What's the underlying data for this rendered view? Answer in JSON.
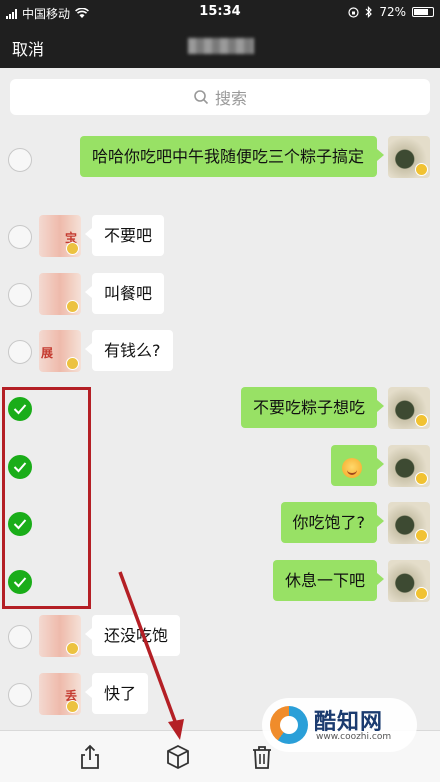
{
  "status_bar": {
    "carrier": "中国移动",
    "time": "15:34",
    "battery": "72%"
  },
  "nav": {
    "cancel_label": "取消"
  },
  "search": {
    "placeholder": "搜索"
  },
  "messages": [
    {
      "side": "me",
      "text": "哈哈你吃吧中午我随便吃三个粽子搞定",
      "checked": false
    },
    {
      "side": "other",
      "text": "不要吧",
      "checked": false,
      "avatar_mark": "宝"
    },
    {
      "side": "other",
      "text": "叫餐吧",
      "checked": false,
      "avatar_mark": ""
    },
    {
      "side": "other",
      "text": "有钱么?",
      "checked": false,
      "avatar_mark": "展"
    },
    {
      "side": "me",
      "text": "不要吃粽子想吃",
      "checked": true
    },
    {
      "side": "me",
      "text": "",
      "emoji": "grin-emoji",
      "checked": true
    },
    {
      "side": "me",
      "text": "你吃饱了?",
      "checked": true
    },
    {
      "side": "me",
      "text": "休息一下吧",
      "checked": true
    },
    {
      "side": "other",
      "text": "还没吃饱",
      "checked": false,
      "avatar_mark": ""
    },
    {
      "side": "other",
      "text": "快了",
      "checked": false,
      "avatar_mark": "丢"
    }
  ],
  "toolbar": {
    "icons": [
      "share-icon",
      "box-icon",
      "trash-icon"
    ]
  },
  "watermark": {
    "name": "酷知网",
    "site": "www.coozhi.com"
  },
  "colors": {
    "accent_green": "#1aad19",
    "bubble_green": "#98e165",
    "highlight_red": "#b41f25"
  }
}
